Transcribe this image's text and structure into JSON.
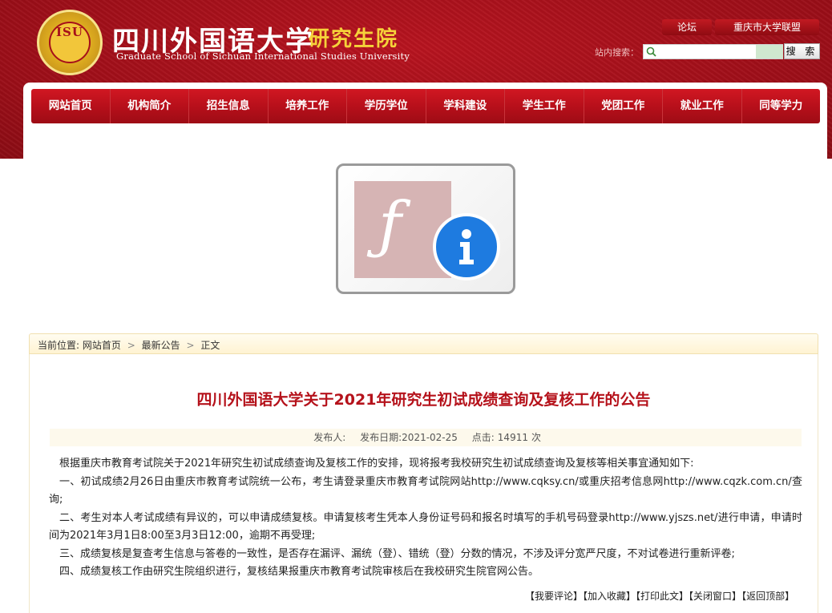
{
  "header": {
    "seal_mark": "ISU",
    "site_name": "四川外国语大学",
    "school_name": "研究生院",
    "english_name": "Graduate School of Sichuan International Studies University",
    "top_links": [
      "论坛",
      "重庆市大学联盟"
    ],
    "search_label": "站内搜索：",
    "search_value": "",
    "search_button": "搜 索"
  },
  "nav": {
    "items": [
      "网站首页",
      "机构简介",
      "招生信息",
      "培养工作",
      "学历学位",
      "学科建设",
      "学生工作",
      "党团工作",
      "就业工作",
      "同等学力"
    ]
  },
  "breadcrumb": {
    "prefix": "当前位置:",
    "items": [
      "网站首页",
      "最新公告",
      "正文"
    ],
    "separator": ">"
  },
  "article": {
    "title": "四川外国语大学关于2021年研究生初试成绩查询及复核工作的公告",
    "author_label": "发布人:",
    "date_label": "发布日期:",
    "date": "2021-02-25",
    "views_label": "点击:",
    "views": "14911",
    "views_unit": "次",
    "paragraphs": [
      "根据重庆市教育考试院关于2021年研究生初试成绩查询及复核工作的安排，现将报考我校研究生初试成绩查询及复核等相关事宜通知如下:",
      "一、初试成绩2月26日由重庆市教育考试院统一公布，考生请登录重庆市教育考试院网站http://www.cqksy.cn/或重庆招考信息网http://www.cqzk.com.cn/查询;",
      "二、考生对本人考试成绩有异议的，可以申请成绩复核。申请复核考生凭本人身份证号码和报名时填写的手机号码登录http://www.yjszs.net/进行申请，申请时间为2021年3月1日8:00至3月3日12:00，逾期不再受理;",
      "三、成绩复核是复查考生信息与答卷的一致性，是否存在漏评、漏统（登）、错统（登）分数的情况，不涉及评分宽严尺度，不对试卷进行重新评卷;",
      "四、成绩复核工作由研究生院组织进行，复核结果报重庆市教育考试院审核后在我校研究生院官网公告。"
    ],
    "actions": [
      "【我要评论】",
      "【加入收藏】",
      "【打印此文】",
      "【关闭窗口】",
      "【返回顶部】"
    ]
  },
  "colors": {
    "brand_red": "#a6101a",
    "title_red": "#b5121b",
    "gold": "#f5d23a"
  }
}
